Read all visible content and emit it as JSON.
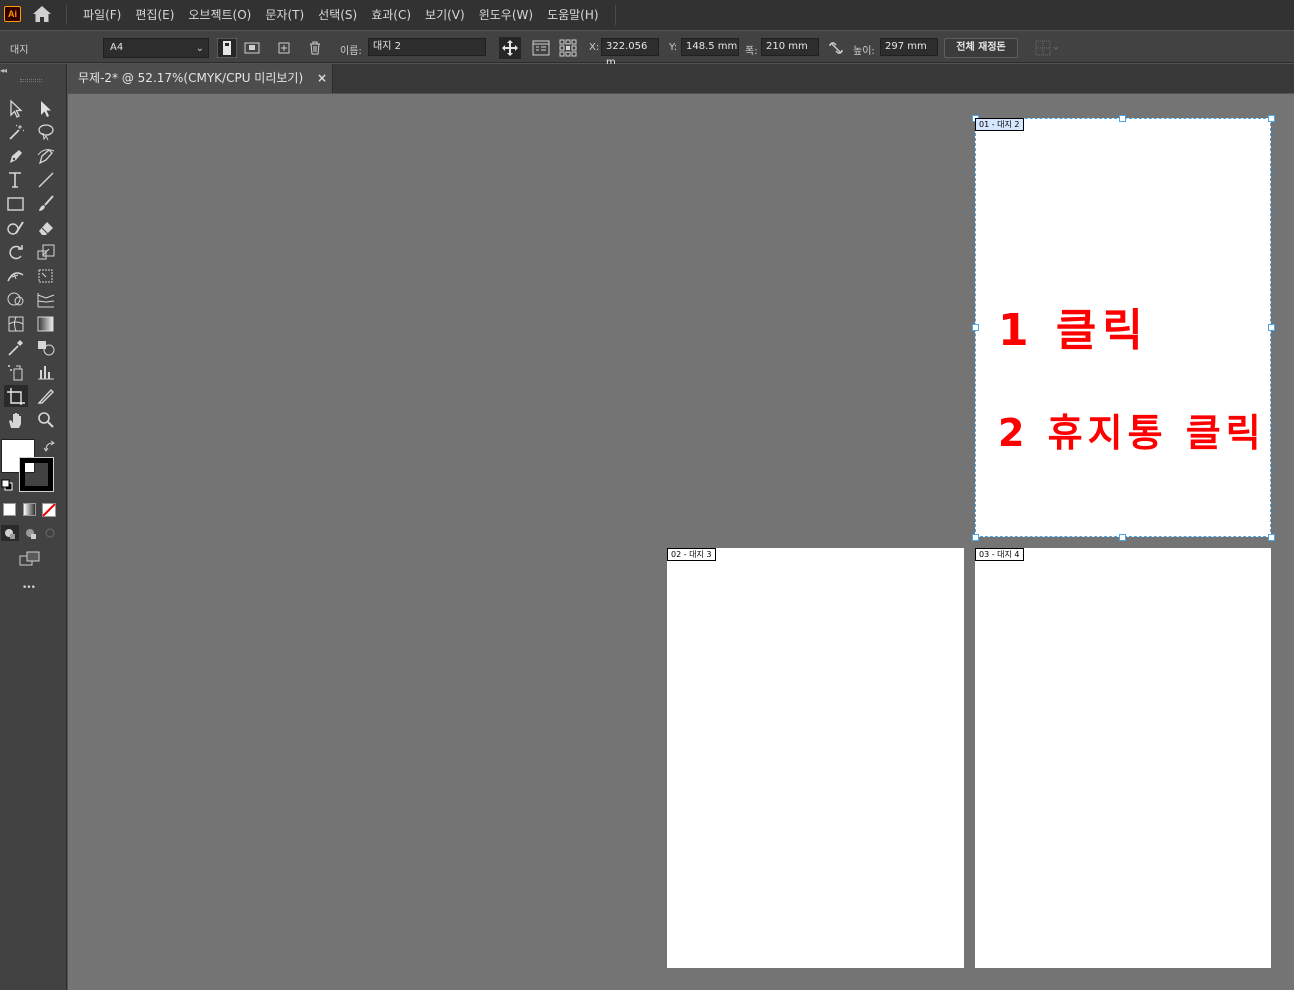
{
  "app": {
    "logo": "Ai"
  },
  "menu": {
    "items": [
      "파일(F)",
      "편집(E)",
      "오브젝트(O)",
      "문자(T)",
      "선택(S)",
      "효과(C)",
      "보기(V)",
      "윈도우(W)",
      "도움말(H)"
    ]
  },
  "control": {
    "panel_label": "대지",
    "preset": "A4",
    "name_label": "이름:",
    "name_value": "대지 2",
    "x_label": "X:",
    "x_value": "322.056 m",
    "y_label": "Y:",
    "y_value": "148.5 mm",
    "width_label": "폭:",
    "width_value": "210 mm",
    "height_label": "높이:",
    "height_value": "297 mm",
    "rearrange_label": "전체 재정돈"
  },
  "document": {
    "tab_title": "무제-2* @ 52.17%(CMYK/CPU 미리보기)",
    "tab_close": "×"
  },
  "artboards": [
    {
      "label": "01 - 대지 2",
      "selected": true
    },
    {
      "label": "02 - 대지 3",
      "selected": false
    },
    {
      "label": "03 - 대지 4",
      "selected": false
    }
  ],
  "annotations": {
    "step1": "1 클릭",
    "step2": "2 휴지통 클릭"
  },
  "toolbar": {
    "more_label": "•••"
  },
  "colors": {
    "annotation": "#ff0000",
    "selection": "#4aa5e8",
    "canvas": "#747474"
  }
}
